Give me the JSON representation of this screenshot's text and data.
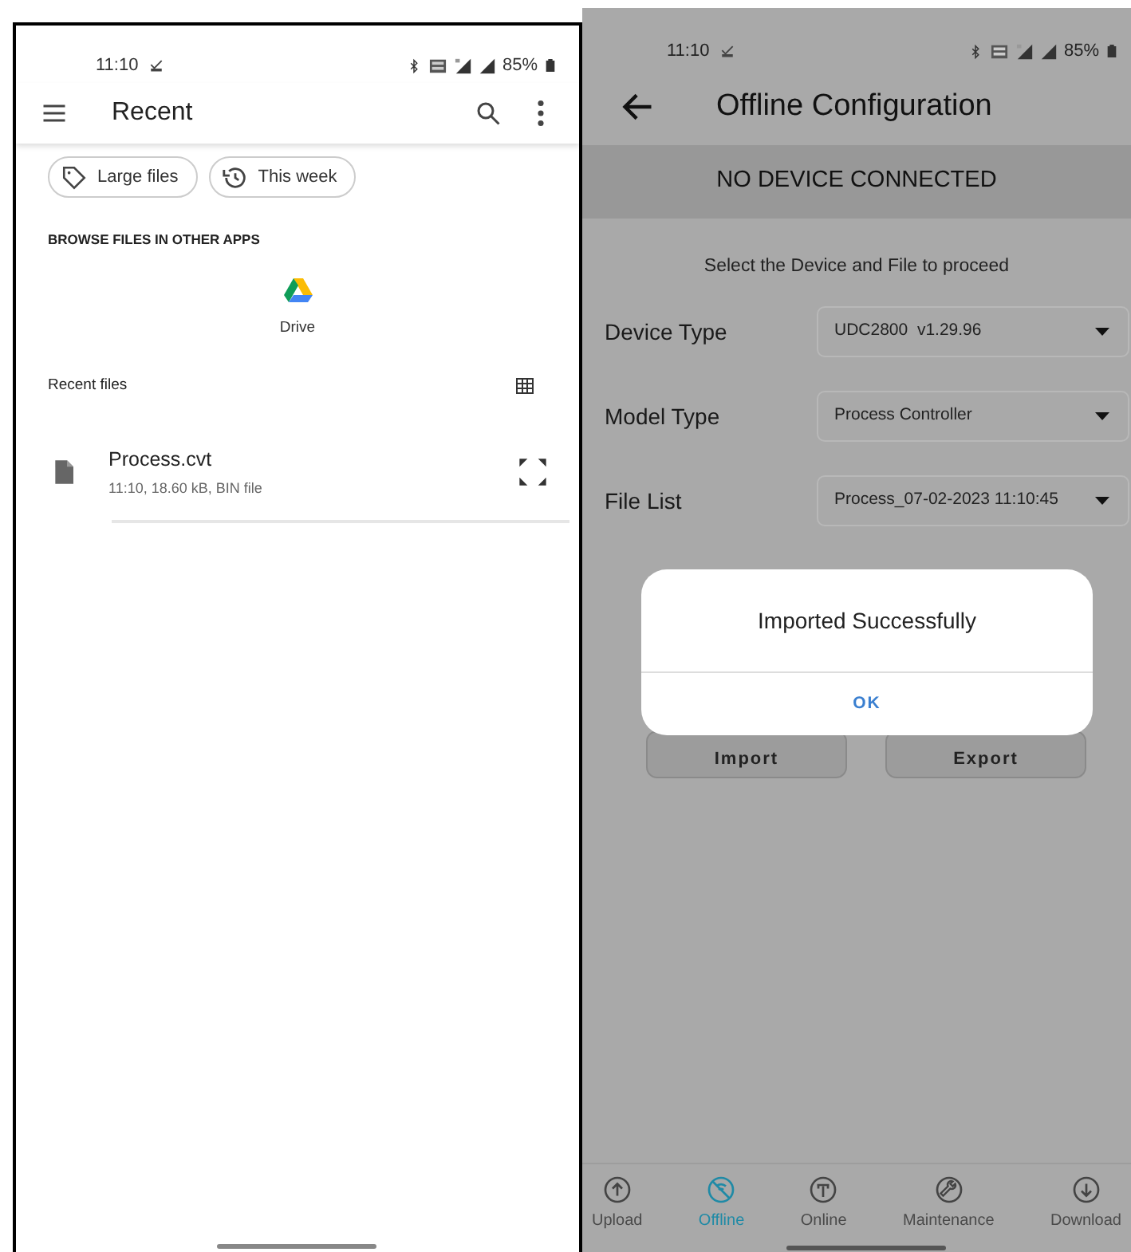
{
  "file_manager": {
    "status_bar": {
      "time": "11:10",
      "battery": "85%"
    },
    "toolbar": {
      "title": "Recent"
    },
    "chips": [
      {
        "label": "Large files",
        "kind": "tag"
      },
      {
        "label": "This week",
        "kind": "history"
      }
    ],
    "browse_heading": "BROWSE FILES IN OTHER APPS",
    "apps": [
      {
        "label": "Drive"
      }
    ],
    "recent_heading": "Recent files",
    "files": [
      {
        "name": "Process.cvt",
        "details": "11:10, 18.60 kB, BIN file"
      }
    ]
  },
  "config_app": {
    "status_bar": {
      "time": "11:10",
      "battery": "85%"
    },
    "title": "Offline Configuration",
    "banner": "NO DEVICE CONNECTED",
    "instruction": "Select the Device and File to proceed",
    "fields": [
      {
        "label": "Device Type",
        "value": "UDC2800  v1.29.96"
      },
      {
        "label": "Model Type",
        "value": "Process Controller"
      },
      {
        "label": "File List",
        "value": "Process_07-02-2023 11:10:45"
      }
    ],
    "buttons": [
      "Import",
      "Export"
    ],
    "dialog": {
      "message": "Imported Successfully",
      "button": "OK"
    },
    "nav": [
      {
        "label": "Upload",
        "kind": "upload",
        "selected": false
      },
      {
        "label": "Offline",
        "kind": "offline",
        "selected": true
      },
      {
        "label": "Online",
        "kind": "online",
        "selected": false
      },
      {
        "label": "Maintenance",
        "kind": "maintenance",
        "selected": false
      },
      {
        "label": "Download",
        "kind": "download",
        "selected": false
      }
    ]
  }
}
